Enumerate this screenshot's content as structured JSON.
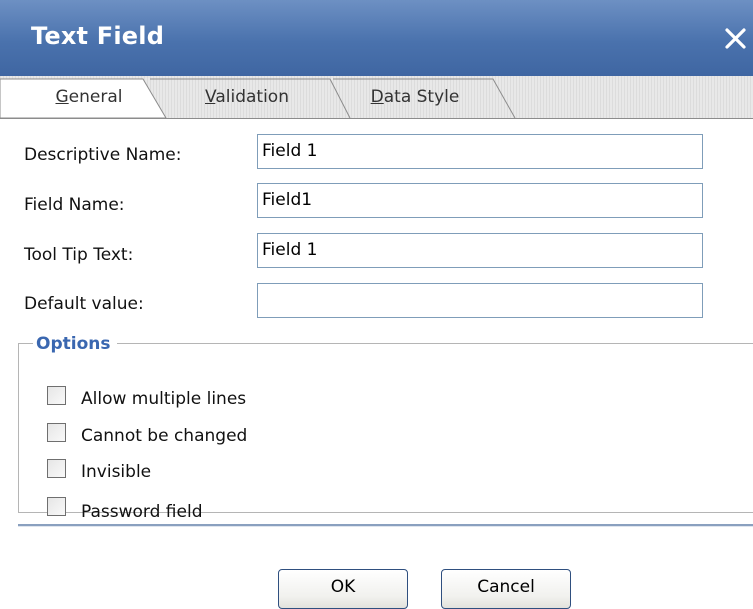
{
  "dialog": {
    "title": "Text Field",
    "close_glyph": "✕",
    "colors": {
      "titlebar": "#4a72ad",
      "legend": "#3a67b0",
      "field_border": "#7f9db9"
    }
  },
  "tabs": [
    {
      "label": "General",
      "mnemonic": "G",
      "rest": "eneral",
      "active": true
    },
    {
      "label": "Validation",
      "mnemonic": "V",
      "rest": "alidation",
      "active": false
    },
    {
      "label": "Data Style",
      "mnemonic": "D",
      "rest": "ata Style",
      "active": false
    }
  ],
  "form": {
    "descriptive_name": {
      "label": "Descriptive Name:",
      "value": "Field 1"
    },
    "field_name": {
      "label": "Field Name:",
      "value": "Field1"
    },
    "tool_tip_text": {
      "label": "Tool Tip Text:",
      "value": "Field 1"
    },
    "default_value": {
      "label": "Default value:",
      "value": ""
    }
  },
  "options": {
    "legend": "Options",
    "items": [
      {
        "label": "Allow multiple lines",
        "checked": false
      },
      {
        "label": "Cannot be changed",
        "checked": false
      },
      {
        "label": "Invisible",
        "checked": false
      },
      {
        "label": "Password field",
        "checked": false
      }
    ]
  },
  "buttons": {
    "ok_label": "OK",
    "cancel_label": "Cancel"
  }
}
